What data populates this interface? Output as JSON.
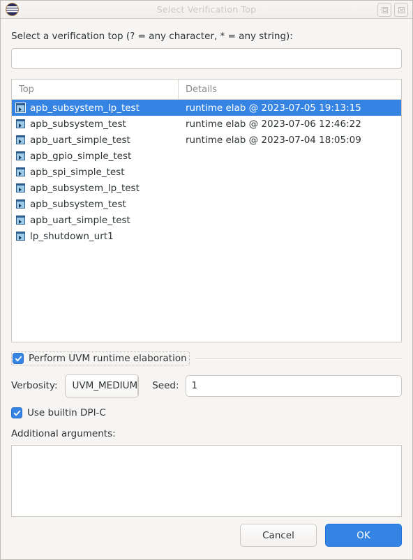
{
  "window": {
    "title": "Select Verification Top",
    "app_icon": "eclipse-icon",
    "buttons": [
      {
        "name": "maximize-button",
        "icon": "maximize-icon"
      },
      {
        "name": "close-button",
        "icon": "close-icon"
      }
    ]
  },
  "colors": {
    "accent": "#3584e4",
    "window_bg": "#f6f5f4",
    "border": "#cdc7c2",
    "text": "#2e3436",
    "header_text": "#8d8a86",
    "title_text": "#cdc9c5"
  },
  "prompt": {
    "label": "Select a verification top (? = any character, * = any string):",
    "filter_value": "",
    "filter_placeholder": ""
  },
  "table": {
    "columns": [
      "Top",
      "Details"
    ],
    "rows": [
      {
        "icon": "verification-top-icon",
        "top": "apb_subsystem_lp_test",
        "details": "runtime elab @ 2023-07-05 19:13:15",
        "selected": true
      },
      {
        "icon": "verification-top-icon",
        "top": "apb_subsystem_test",
        "details": "runtime elab @ 2023-07-06 12:46:22",
        "selected": false
      },
      {
        "icon": "verification-top-icon",
        "top": "apb_uart_simple_test",
        "details": "runtime elab @ 2023-07-04 18:05:09",
        "selected": false
      },
      {
        "icon": "verification-top-icon",
        "top": "apb_gpio_simple_test",
        "details": "",
        "selected": false
      },
      {
        "icon": "verification-top-icon",
        "top": "apb_spi_simple_test",
        "details": "",
        "selected": false
      },
      {
        "icon": "verification-top-icon",
        "top": "apb_subsystem_lp_test",
        "details": "",
        "selected": false
      },
      {
        "icon": "verification-top-icon",
        "top": "apb_subsystem_test",
        "details": "",
        "selected": false
      },
      {
        "icon": "verification-top-icon",
        "top": "apb_uart_simple_test",
        "details": "",
        "selected": false
      },
      {
        "icon": "verification-top-icon",
        "top": "lp_shutdown_urt1",
        "details": "",
        "selected": false
      }
    ]
  },
  "options": {
    "uvm_elab_label": "Perform UVM runtime elaboration",
    "uvm_elab_checked": true,
    "verbosity_label": "Verbosity:",
    "verbosity_value": "UVM_MEDIUM",
    "verbosity_arrow_icon": "chevron-down-icon",
    "seed_label": "Seed:",
    "seed_value": "1",
    "dpi_label": "Use builtin DPI-C",
    "dpi_checked": true,
    "args_label": "Additional arguments:",
    "args_value": "",
    "args_placeholder": ""
  },
  "footer": {
    "cancel_label": "Cancel",
    "ok_label": "OK"
  }
}
